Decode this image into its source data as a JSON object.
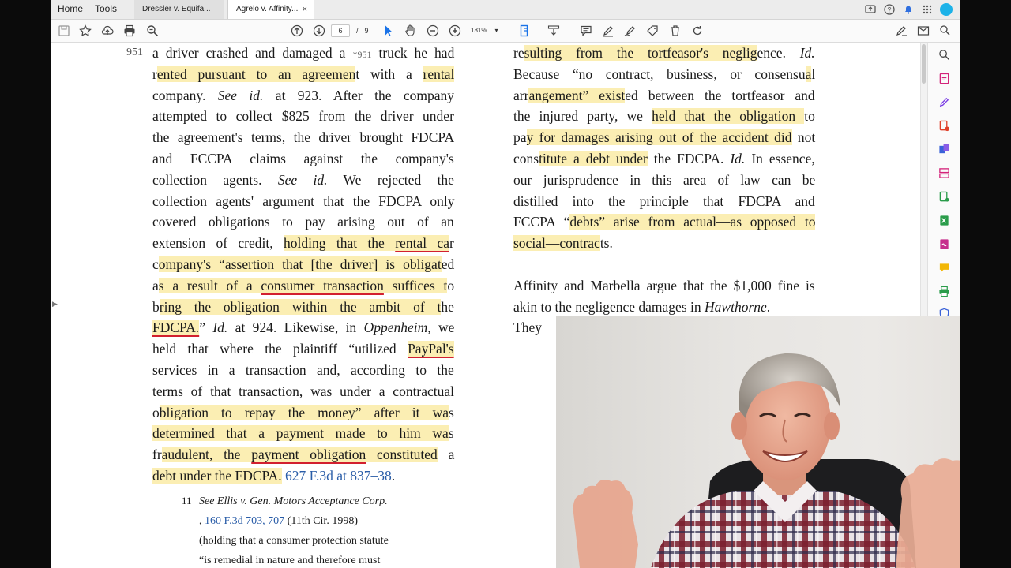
{
  "nav": {
    "home": "Home",
    "tools": "Tools"
  },
  "tabs": [
    {
      "label": "Dressler v. Equifa...",
      "active": false
    },
    {
      "label": "Agrelo v. Affinity...",
      "active": true,
      "close": "×"
    }
  ],
  "toolbar": {
    "page_current": "6",
    "page_sep": "/",
    "page_total": "9",
    "zoom": "181%"
  },
  "document": {
    "page_marker": "951",
    "left_lines": [
      [
        {
          "t": "a driver crashed and damaged a "
        },
        {
          "t": "*951",
          "c": "star"
        },
        {
          "t": " truck he had"
        }
      ],
      [
        {
          "t": "r"
        },
        {
          "t": "ented pursuant to an agreemen",
          "c": "hl"
        },
        {
          "t": "t with a "
        },
        {
          "t": "rental",
          "c": "hl"
        }
      ],
      [
        {
          "t": "company. "
        },
        {
          "t": "See id.",
          "c": "it"
        },
        {
          "t": " at 923. After the company"
        }
      ],
      [
        {
          "t": "attempted to collect $825 from the driver under"
        }
      ],
      [
        {
          "t": "the agreement's terms, the driver brought FDCPA"
        }
      ],
      [
        {
          "t": "and FCCPA claims against the company's"
        }
      ],
      [
        {
          "t": "collection agents. "
        },
        {
          "t": "See id.",
          "c": "it"
        },
        {
          "t": " We rejected the"
        }
      ],
      [
        {
          "t": "collection agents' argument that the FDCPA only"
        }
      ],
      [
        {
          "t": "covered obligations to pay arising out of an"
        }
      ],
      [
        {
          "t": "extension of credit, "
        },
        {
          "t": "holding that the ",
          "c": "hl"
        },
        {
          "t": "rental ca",
          "c": "hl ul"
        },
        {
          "t": "r"
        }
      ],
      [
        {
          "t": "c"
        },
        {
          "t": "ompany's “assertion that [the driver] is obligat",
          "c": "hl"
        },
        {
          "t": "ed"
        }
      ],
      [
        {
          "t": "a"
        },
        {
          "t": "s a result of a ",
          "c": "hl"
        },
        {
          "t": "consumer transaction",
          "c": "hl ul"
        },
        {
          "t": " suffices t",
          "c": "hl"
        },
        {
          "t": "o"
        }
      ],
      [
        {
          "t": "b"
        },
        {
          "t": "ring the obligation within the ambit of t",
          "c": "hl"
        },
        {
          "t": "he"
        }
      ],
      [
        {
          "t": "FDCPA.",
          "c": "hl ul"
        },
        {
          "t": "” "
        },
        {
          "t": "Id.",
          "c": "it"
        },
        {
          "t": " at 924. Likewise, in "
        },
        {
          "t": "Oppenheim",
          "c": "it"
        },
        {
          "t": ", we"
        }
      ],
      [
        {
          "t": "held that where the plaintiff “utilized "
        },
        {
          "t": "PayPal's",
          "c": "hl ul"
        }
      ],
      [
        {
          "t": "services in a transaction and, according to the"
        }
      ],
      [
        {
          "t": "terms of that transaction, was under a contractual"
        }
      ],
      [
        {
          "t": "o"
        },
        {
          "t": "bligation to repay the money” after it wa",
          "c": "hl"
        },
        {
          "t": "s"
        }
      ],
      [
        {
          "t": "determined that a payment made to him wa",
          "c": "hl"
        },
        {
          "t": "s"
        }
      ],
      [
        {
          "t": "fr"
        },
        {
          "t": "audulent, the ",
          "c": "hl"
        },
        {
          "t": "payment obligation",
          "c": "hl ul"
        },
        {
          "t": " constituted",
          "c": "hl"
        },
        {
          "t": " a"
        }
      ],
      [
        {
          "t": "debt under the FDCPA.",
          "c": "hl"
        },
        {
          "t": " "
        },
        {
          "t": "627 F.3d at 837–38",
          "c": "link"
        },
        {
          "t": "."
        }
      ]
    ],
    "right_lines": [
      [
        {
          "t": "re"
        },
        {
          "t": "sulting from the tortfeasor's neglig",
          "c": "hl"
        },
        {
          "t": "ence. "
        },
        {
          "t": "Id.",
          "c": "it"
        }
      ],
      [
        {
          "t": "Because “no contract, business, or consensu"
        },
        {
          "t": "a",
          "c": "hl"
        },
        {
          "t": "l"
        }
      ],
      [
        {
          "t": "arr"
        },
        {
          "t": "angement” exist",
          "c": "hl"
        },
        {
          "t": "ed between the tortfeasor and"
        }
      ],
      [
        {
          "t": "the injured party, we "
        },
        {
          "t": "held that the obligation ",
          "c": "hl"
        },
        {
          "t": "to"
        }
      ],
      [
        {
          "t": "pa"
        },
        {
          "t": "y for damages arising out of the accident did",
          "c": "hl"
        },
        {
          "t": " not"
        }
      ],
      [
        {
          "t": "cons"
        },
        {
          "t": "titute a debt under",
          "c": "hl"
        },
        {
          "t": " the FDCPA. "
        },
        {
          "t": "Id.",
          "c": "it"
        },
        {
          "t": " In essence,"
        }
      ],
      [
        {
          "t": "our jurisprudence in this area of law can be"
        }
      ],
      [
        {
          "t": "distilled into the principle that FDCPA and"
        }
      ],
      [
        {
          "t": "FCCPA “"
        },
        {
          "t": "debts” arise from actual—as opposed to",
          "c": "hl"
        }
      ],
      [
        {
          "t": "social—contrac",
          "c": "hl"
        },
        {
          "t": "ts."
        }
      ],
      [
        {
          "t": " "
        }
      ],
      [
        {
          "t": "Affinity and Marbella argue that the $1,000 fine is"
        }
      ],
      [
        {
          "t": "akin to the negligence damages in "
        },
        {
          "t": "Hawthorne",
          "c": "it"
        },
        {
          "t": "."
        }
      ],
      [
        {
          "t": "They also rely on cases holding that a"
        }
      ]
    ],
    "footnote_number": "11",
    "footnote_lines": [
      [
        {
          "t": "See Ellis v. Gen. Motors Acceptance Corp.",
          "c": "it"
        }
      ],
      [
        {
          "t": ", "
        },
        {
          "t": "160 F.3d 703, 707",
          "c": "link"
        },
        {
          "t": " (11th Cir. 1998)"
        }
      ],
      [
        {
          "t": "(holding that a consumer protection statute"
        }
      ],
      [
        {
          "t": "“is remedial in nature and therefore must"
        }
      ]
    ]
  },
  "colors": {
    "highlight": "#fbeeb3",
    "underline": "#d2202f",
    "link": "#2a5da8",
    "accent": "#1a73e8"
  }
}
